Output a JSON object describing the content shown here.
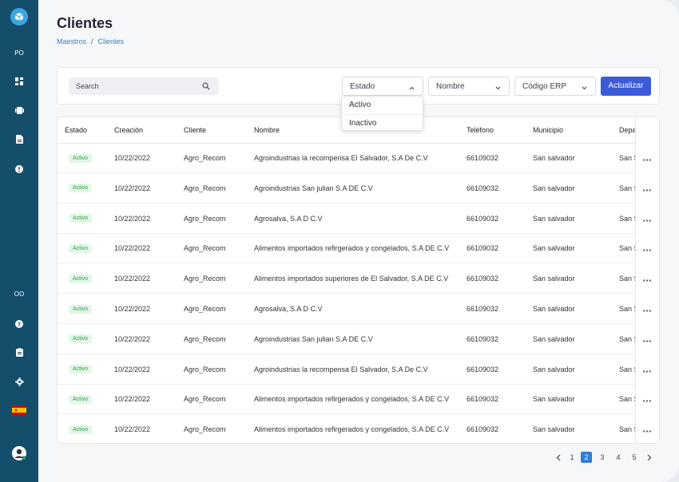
{
  "page": {
    "title": "Clientes",
    "breadcrumb": [
      "Maestros",
      "Clientes"
    ]
  },
  "sidebar": {
    "top_label": "PO",
    "bottom_label": "OO",
    "icons": [
      "dashboard-icon",
      "card-icon",
      "document-icon",
      "alert-icon",
      "help-icon",
      "clipboard-icon",
      "gear-icon",
      "spain-flag-icon",
      "avatar"
    ]
  },
  "filters": {
    "search_placeholder": "Search",
    "estado_label": "Estado",
    "nombre_label": "Nombre",
    "codigo_label": "Código ERP",
    "update_label": "Actualizar",
    "estado_options": [
      "Activo",
      "Inactivo"
    ]
  },
  "table": {
    "columns": [
      "Estado",
      "Creación",
      "Cliente",
      "Nombre",
      "Teléfono",
      "Municipio",
      "Depa"
    ],
    "rows": [
      {
        "estado": "Activo",
        "creacion": "10/22/2022",
        "cliente": "Agro_Recom",
        "nombre": "Agroindustrias la recompensa El Salvador, S.A De C.V",
        "telefono": "66109032",
        "municipio": "San salvador",
        "depa": "San S"
      },
      {
        "estado": "Activo",
        "creacion": "10/22/2022",
        "cliente": "Agro_Recom",
        "nombre": "Agroindustrias San julian S.A DE C.V",
        "telefono": "66109032",
        "municipio": "San salvador",
        "depa": "San S"
      },
      {
        "estado": "Activo",
        "creacion": "10/22/2022",
        "cliente": "Agro_Recom",
        "nombre": "Agrosalva, S.A D C.V",
        "telefono": "66109032",
        "municipio": "San salvador",
        "depa": "San S"
      },
      {
        "estado": "Activo",
        "creacion": "10/22/2022",
        "cliente": "Agro_Recom",
        "nombre": "Alimentos importados refirgerados y congelados, S.A DE C.V",
        "telefono": "66109032",
        "municipio": "San salvador",
        "depa": "San S"
      },
      {
        "estado": "Activo",
        "creacion": "10/22/2022",
        "cliente": "Agro_Recom",
        "nombre": "Alimentos importados superiores de El Salvador, S.A DE C.V",
        "telefono": "66109032",
        "municipio": "San salvador",
        "depa": "San S"
      },
      {
        "estado": "Activo",
        "creacion": "10/22/2022",
        "cliente": "Agro_Recom",
        "nombre": "Agrosalva, S.A D C.V",
        "telefono": "66109032",
        "municipio": "San salvador",
        "depa": "San S"
      },
      {
        "estado": "Activo",
        "creacion": "10/22/2022",
        "cliente": "Agro_Recom",
        "nombre": "Agroindustrias San julian S.A DE C.V",
        "telefono": "66109032",
        "municipio": "San salvador",
        "depa": "San S"
      },
      {
        "estado": "Activo",
        "creacion": "10/22/2022",
        "cliente": "Agro_Recom",
        "nombre": "Agroindustrias la recompensa El Salvador, S.A De C.V",
        "telefono": "66109032",
        "municipio": "San salvador",
        "depa": "San S"
      },
      {
        "estado": "Activo",
        "creacion": "10/22/2022",
        "cliente": "Agro_Recom",
        "nombre": "Alimentos importados refirgerados y congelados, S.A DE C.V",
        "telefono": "66109032",
        "municipio": "San salvador",
        "depa": "San S"
      },
      {
        "estado": "Activo",
        "creacion": "10/22/2022",
        "cliente": "Agro_Recom",
        "nombre": "Alimentos importados refirgerados y congelados, S.A DE C.V",
        "telefono": "66109032",
        "municipio": "San salvador",
        "depa": "San S"
      }
    ]
  },
  "pagination": {
    "pages": [
      "1",
      "2",
      "3",
      "4",
      "5"
    ],
    "current": "2"
  },
  "colors": {
    "sidebar": "#154e6b",
    "accent": "#3b5bdb",
    "active_badge_bg": "#e2f7e6",
    "active_badge_text": "#2f9d4a"
  }
}
